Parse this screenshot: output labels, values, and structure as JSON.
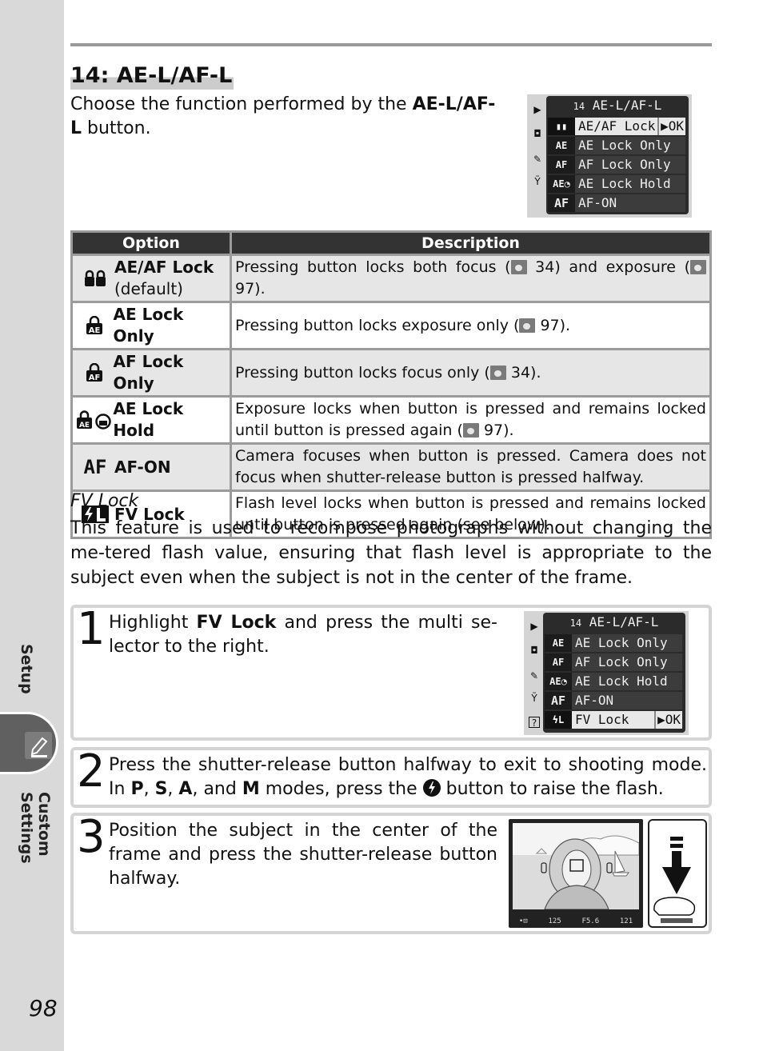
{
  "sidebar": {
    "section_above": "Setup",
    "active_section": "Custom Settings",
    "active_icon": "pencil-icon",
    "page_number": "98"
  },
  "heading": "14: AE-L/AF-L",
  "intro": {
    "text_before": "Choose the function performed by the ",
    "bold": "AE-L/AF-L",
    "text_after": " button."
  },
  "menu_screen_1": {
    "number": "14",
    "title": "AE-L/AF-L",
    "side_icons": [
      "play-icon",
      "camera-icon",
      "pencil-icon",
      "wrench-icon"
    ],
    "items": [
      {
        "icon": "lock-pair-icon",
        "label": "AE/AF Lock",
        "selected": true,
        "ok": "▶OK"
      },
      {
        "icon": "ae-lock-icon",
        "label": "AE Lock Only"
      },
      {
        "icon": "af-lock-icon",
        "label": "AF Lock Only"
      },
      {
        "icon": "ae-lock-hold-icon",
        "label": "AE Lock Hold"
      },
      {
        "icon": "af-icon",
        "label": "AF-ON"
      }
    ]
  },
  "table": {
    "headers": [
      "Option",
      "Description"
    ],
    "rows": [
      {
        "icon": "lock-pair-icon",
        "icon_text": "🔒🔒",
        "option": "AE/AF Lock",
        "option_sub": "(default)",
        "desc_parts": [
          "Pressing button locks both focus (",
          "34) and exposure (",
          "97)."
        ]
      },
      {
        "icon": "ae-lock-icon",
        "icon_text": "AE",
        "option": "AE Lock Only",
        "desc_parts": [
          "Pressing button locks exposure only (",
          "97)."
        ]
      },
      {
        "icon": "af-lock-icon",
        "icon_text": "AF",
        "option": "AF Lock Only",
        "desc_parts": [
          "Pressing button locks focus only (",
          "34)."
        ]
      },
      {
        "icon": "ae-lock-hold-icon",
        "icon_text": "AE⏱",
        "option": "AE Lock Hold",
        "desc_parts": [
          "Exposure locks when button is pressed and remains locked until button is pressed again (",
          "97)."
        ]
      },
      {
        "icon": "af-icon",
        "icon_text": "AF",
        "option": "AF-ON",
        "desc_parts": [
          "Camera focuses when button is pressed.  Camera does not focus when shutter-release button is pressed halfway."
        ]
      },
      {
        "icon": "fv-lock-icon",
        "icon_text": "ϟL",
        "option": "FV Lock",
        "desc_parts": [
          "Flash level locks when button is pressed and remains locked until button is pressed again (see below)."
        ]
      }
    ]
  },
  "fv_lock": {
    "title": "FV Lock",
    "body": "This feature is used to recompose photographs without changing the me-tered flash value, ensuring that flash level is appropriate to the subject even when the subject is not in the center of the frame."
  },
  "steps": [
    {
      "number": "1",
      "parts": [
        "Highlight ",
        "FV Lock",
        " and press the multi se-lector to the right."
      ]
    },
    {
      "number": "2",
      "parts": [
        "Press the shutter-release button halfway to exit to shooting mode.  In ",
        "P",
        ", ",
        "S",
        ", ",
        "A",
        ", and ",
        "M",
        " modes, press the ",
        " button to raise the flash."
      ]
    },
    {
      "number": "3",
      "parts": [
        "Position the subject in the center of the frame and press the shutter-release button halfway."
      ]
    }
  ],
  "menu_screen_2": {
    "number": "14",
    "title": "AE-L/AF-L",
    "side_icons": [
      "play-icon",
      "camera-icon",
      "pencil-icon",
      "wrench-icon",
      "help-icon"
    ],
    "items": [
      {
        "icon": "ae-lock-icon",
        "label": "AE Lock Only"
      },
      {
        "icon": "af-lock-icon",
        "label": "AF Lock Only"
      },
      {
        "icon": "ae-lock-hold-icon",
        "label": "AE Lock Hold"
      },
      {
        "icon": "af-icon",
        "label": "AF-ON"
      },
      {
        "icon": "fv-lock-icon",
        "label": "FV Lock",
        "selected": true,
        "ok": "▶OK"
      }
    ]
  },
  "viewfinder": {
    "shutter": "125",
    "aperture": "F5.6",
    "frames": "121"
  }
}
